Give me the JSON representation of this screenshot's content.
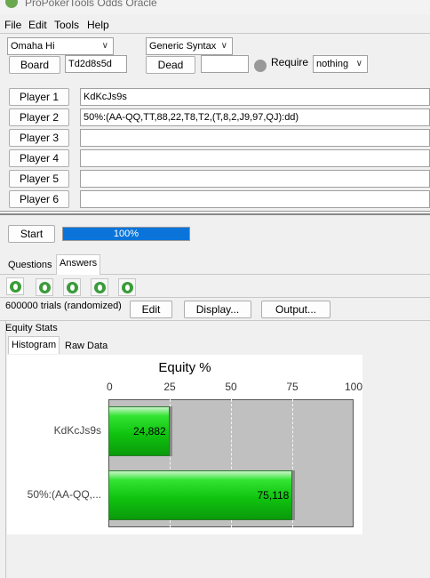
{
  "window": {
    "title": "ProPokerTools Odds Oracle"
  },
  "menu": [
    "File",
    "Edit",
    "Tools",
    "Help"
  ],
  "settings": {
    "game": "Omaha Hi",
    "syntax": "Generic Syntax",
    "board_label": "Board",
    "board_value": "Td2d8s5d",
    "dead_label": "Dead",
    "dead_value": "",
    "require_label": "Require",
    "require_value": "nothing"
  },
  "players": [
    {
      "label": "Player 1",
      "value": "KdKcJs9s"
    },
    {
      "label": "Player 2",
      "value": "50%:(AA-QQ,TT,88,22,T8,T2,(T,8,2,J9,97,QJ):dd)"
    },
    {
      "label": "Player 3",
      "value": ""
    },
    {
      "label": "Player 4",
      "value": ""
    },
    {
      "label": "Player 5",
      "value": ""
    },
    {
      "label": "Player 6",
      "value": ""
    }
  ],
  "run": {
    "start_label": "Start",
    "progress_text": "100%",
    "progress_fraction": 1.0
  },
  "tabs": {
    "questions": "Questions",
    "answers": "Answers"
  },
  "answer_bar": {
    "trials_text": "600000 trials (randomized)",
    "edit_label": "Edit",
    "display_label": "Display...",
    "output_label": "Output..."
  },
  "equity": {
    "section_title": "Equity Stats",
    "tab_histogram": "Histogram",
    "tab_raw": "Raw Data"
  },
  "chart_data": {
    "type": "bar",
    "orientation": "horizontal",
    "title": "Equity %",
    "categories": [
      "KdKcJs9s",
      "50%:(AA-QQ,..."
    ],
    "values": [
      24.882,
      75.118
    ],
    "value_labels": [
      "24,882",
      "75,118"
    ],
    "xlim": [
      0,
      100
    ],
    "ticks": [
      0,
      25,
      50,
      75,
      100
    ],
    "grid": true,
    "bar_color": "#10c410",
    "plot_background": "#c0c0c0"
  }
}
